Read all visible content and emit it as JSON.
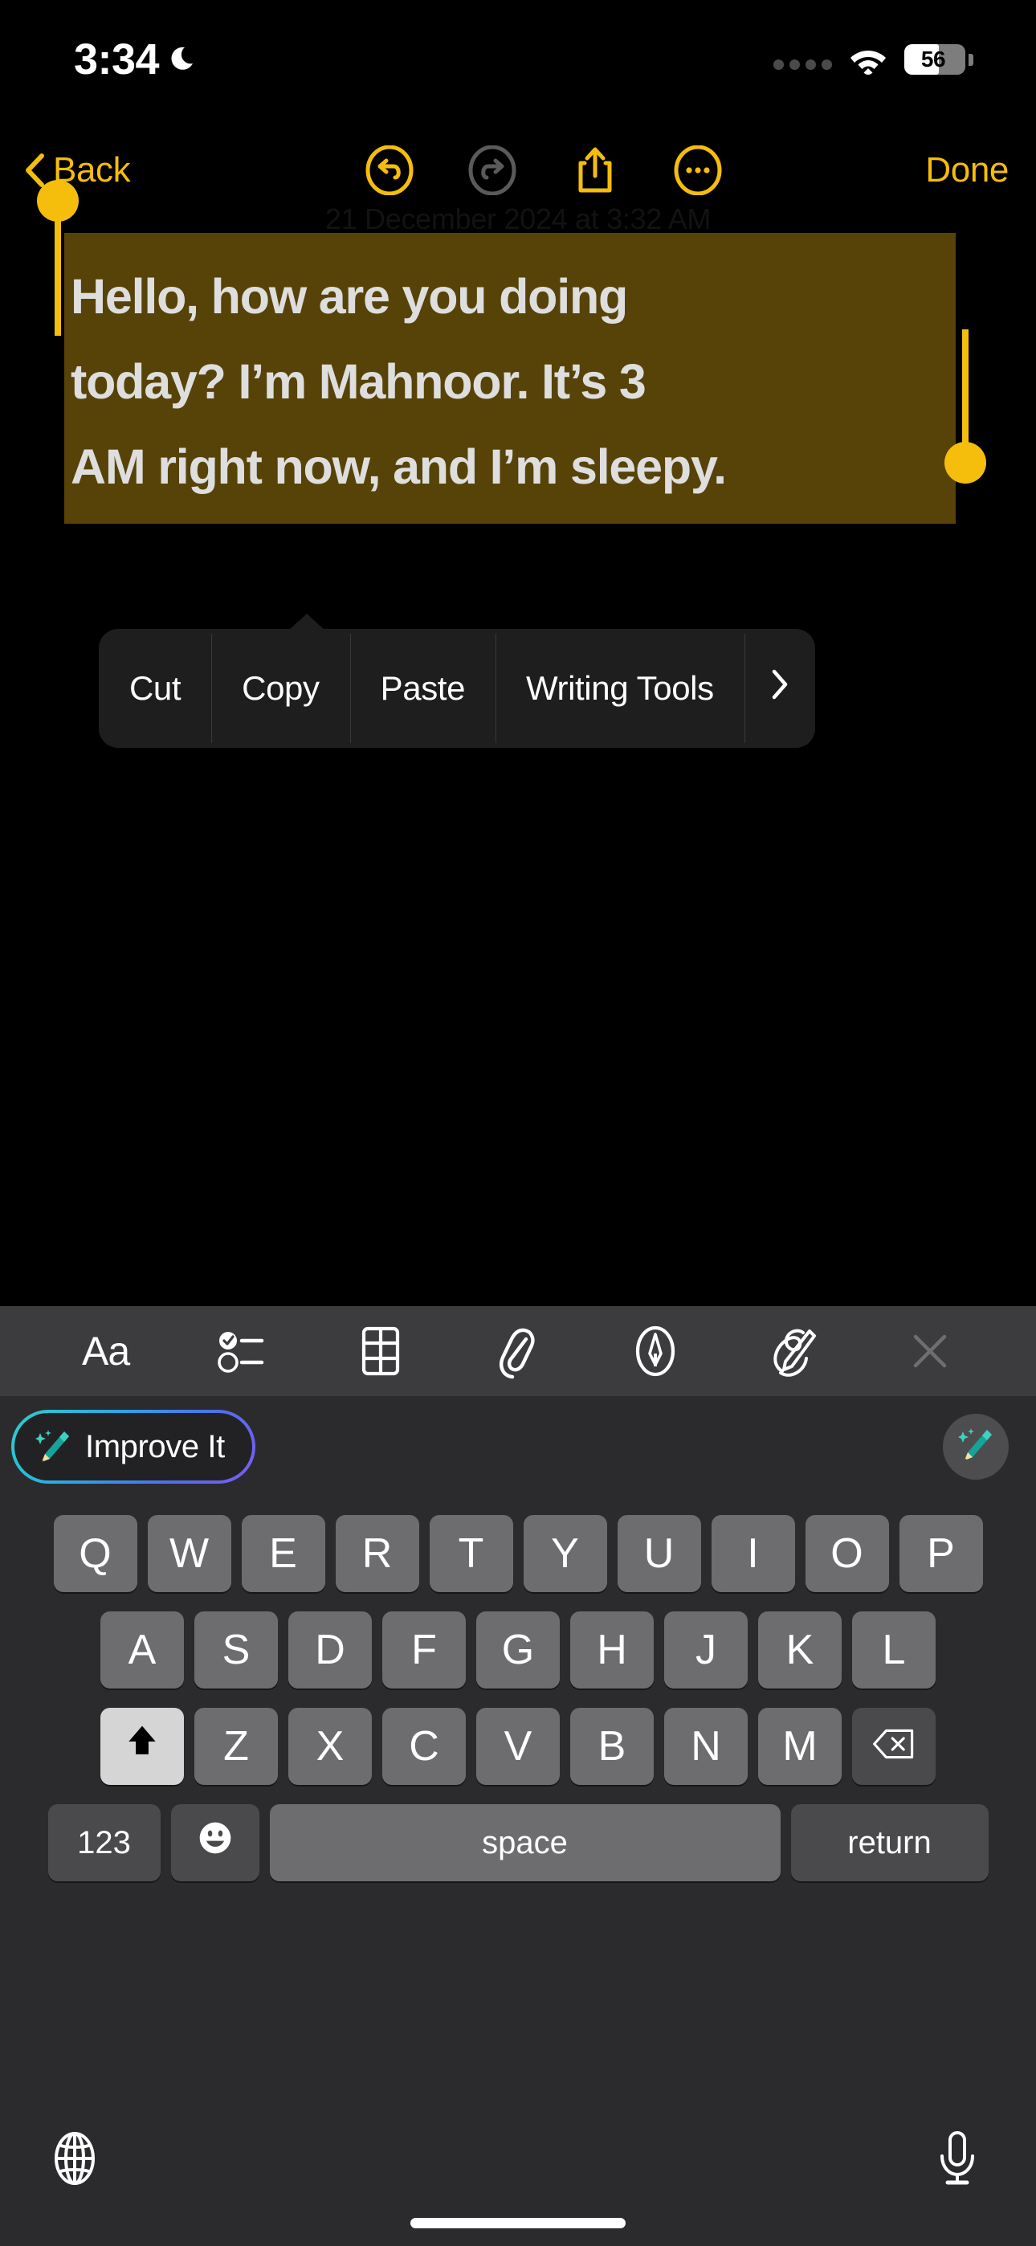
{
  "status_bar": {
    "time": "3:34",
    "moon_icon": "crescent-moon-icon",
    "signal_icon": "cellular-dots-icon",
    "wifi_icon": "wifi-icon",
    "battery_level": "56",
    "battery_percent": 56
  },
  "nav_bar": {
    "back_label": "Back",
    "back_icon": "chevron-left-icon",
    "undo_icon": "undo-icon",
    "redo_icon": "redo-icon",
    "share_icon": "share-icon",
    "more_icon": "ellipsis-circle-icon",
    "done_label": "Done",
    "accent_color": "#F5BD0C"
  },
  "note": {
    "date": "21 December 2024 at 3:32 AM",
    "lines": [
      "Hello, how are you doing",
      "today? I’m Mahnoor. It’s 3",
      "AM right now, and I’m sleepy."
    ],
    "full_text": "Hello, how are you doing today? I’m Mahnoor. It’s 3 AM right now, and I’m sleepy.",
    "selection_color": "#574307",
    "handle_color": "#F5BD0C",
    "text_color": "#dedede"
  },
  "context_menu": {
    "items": [
      {
        "label": "Cut",
        "name": "cut"
      },
      {
        "label": "Copy",
        "name": "copy"
      },
      {
        "label": "Paste",
        "name": "paste"
      },
      {
        "label": "Writing Tools",
        "name": "writing-tools"
      }
    ],
    "more_arrow_icon": "chevron-right-icon",
    "background": "#1e1e1e"
  },
  "format_toolbar": {
    "items": [
      {
        "name": "text-format-icon",
        "label": "Aa"
      },
      {
        "name": "checklist-icon",
        "label": ""
      },
      {
        "name": "table-icon",
        "label": ""
      },
      {
        "name": "attachment-paperclip-icon",
        "label": ""
      },
      {
        "name": "markup-pen-icon",
        "label": ""
      },
      {
        "name": "scribble-icon",
        "label": ""
      },
      {
        "name": "close-icon",
        "label": ""
      }
    ],
    "background": "#3c3c3e"
  },
  "suggestion_bar": {
    "improve_label": "Improve It",
    "improve_icon": "magic-pencil-icon",
    "assistant_icon": "magic-pencil-icon",
    "gradient_colors": [
      "#2fd0c8",
      "#2aa8e8",
      "#4f6ff0",
      "#7b5bf0"
    ]
  },
  "keyboard": {
    "row1": [
      "Q",
      "W",
      "E",
      "R",
      "T",
      "Y",
      "U",
      "I",
      "O",
      "P"
    ],
    "row2": [
      "A",
      "S",
      "D",
      "F",
      "G",
      "H",
      "J",
      "K",
      "L"
    ],
    "row3": [
      "Z",
      "X",
      "C",
      "V",
      "B",
      "N",
      "M"
    ],
    "shift_icon": "shift-up-arrow-icon",
    "backspace_icon": "backspace-delete-icon",
    "numbers_label": "123",
    "emoji_icon": "emoji-smiley-icon",
    "space_label": "space",
    "return_label": "return",
    "globe_icon": "globe-language-icon",
    "mic_icon": "microphone-dictation-icon",
    "shift_active": true,
    "key_color": "#6d6d6f",
    "special_key_color": "#4a4a4c",
    "shift_active_color": "#d5d5d5"
  }
}
